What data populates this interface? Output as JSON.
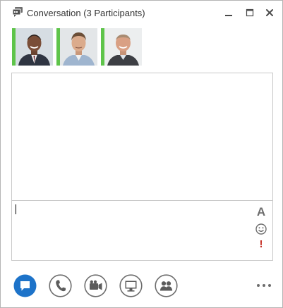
{
  "window": {
    "title": "Conversation (3 Participants)"
  },
  "participants": [
    {
      "presence": "available",
      "presence_color": "#5ec44a",
      "photo": "participant-1-photo"
    },
    {
      "presence": "available",
      "presence_color": "#5ec44a",
      "photo": "participant-2-photo"
    },
    {
      "presence": "available",
      "presence_color": "#5ec44a",
      "photo": "participant-3-photo"
    }
  ],
  "toolbar": {
    "buttons": [
      {
        "name": "im",
        "icon": "chat-bubble-icon",
        "active": true
      },
      {
        "name": "call",
        "icon": "phone-icon",
        "active": false
      },
      {
        "name": "video",
        "icon": "video-camera-icon",
        "active": false
      },
      {
        "name": "present",
        "icon": "monitor-icon",
        "active": false
      },
      {
        "name": "participants",
        "icon": "people-icon",
        "active": false
      }
    ],
    "more": "more-options-icon"
  },
  "compose": {
    "tools": [
      "font-icon",
      "emoticon-icon",
      "priority-icon"
    ]
  },
  "colors": {
    "accent": "#1d73c9",
    "presence_available": "#5ec44a",
    "icon_gray": "#6d6d6d",
    "priority_red": "#c63127"
  }
}
